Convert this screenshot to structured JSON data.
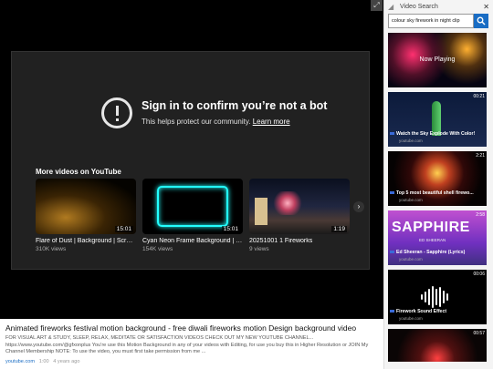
{
  "window": {
    "resize_icon": "resize-icon"
  },
  "player": {
    "signin_heading": "Sign in to confirm you’re not a bot",
    "signin_sub_prefix": "This helps protect our community.",
    "signin_link": "Learn more",
    "more_videos_label": "More videos on YouTube",
    "cards": [
      {
        "duration": "15:01",
        "title": "Flare of Dust | Background | Scree...",
        "views": "310K views"
      },
      {
        "duration": "15:01",
        "title": "Cyan Neon Frame Background | M...",
        "views": "154K views"
      },
      {
        "duration": "1:19",
        "title": "20251001 1 Fireworks",
        "views": "9 views"
      }
    ],
    "next_label": "›"
  },
  "description": {
    "title": "Animated fireworks festival motion background - free diwali fireworks motion Design background video",
    "body": "FOR VISUAL ART & STUDY, SLEEP, RELAX, MEDITATE OR SATISFACTION VIDEOS CHECK OUT MY NEW YOUTUBE CHANNEL... https://www.youtube.com/@gfxonplus You're use this Motion Background in any of your videos with Editing, for use you buy this in Higher Resolution or JOIN My Channel Membership NOTE: To use the video, you must first take permission from me ...",
    "source": "youtube.com",
    "duration": "1:00",
    "age": "4 years ago"
  },
  "panel": {
    "title": "Video Search",
    "close": "✕",
    "search_value": "colour sky firework in night clip",
    "now_playing": "Now Playing",
    "results": [
      {
        "duration": "00:21",
        "title": "Watch the Sky Explode With Color!",
        "source": "youtube.com"
      },
      {
        "duration": "2:21",
        "title": "Top 5 most beautiful shell firewo...",
        "source": "youtube.com"
      },
      {
        "duration": "2:58",
        "title": "Ed Sheeran - Sapphire (Lyrics)",
        "source": "youtube.com",
        "thumb_text": "SAPPHIRE",
        "thumb_sub": "ED SHEERAN"
      },
      {
        "duration": "00:06",
        "title": "Firework Sound Effect",
        "source": "youtube.com"
      },
      {
        "duration": "00:57",
        "title": "",
        "source": ""
      }
    ]
  }
}
